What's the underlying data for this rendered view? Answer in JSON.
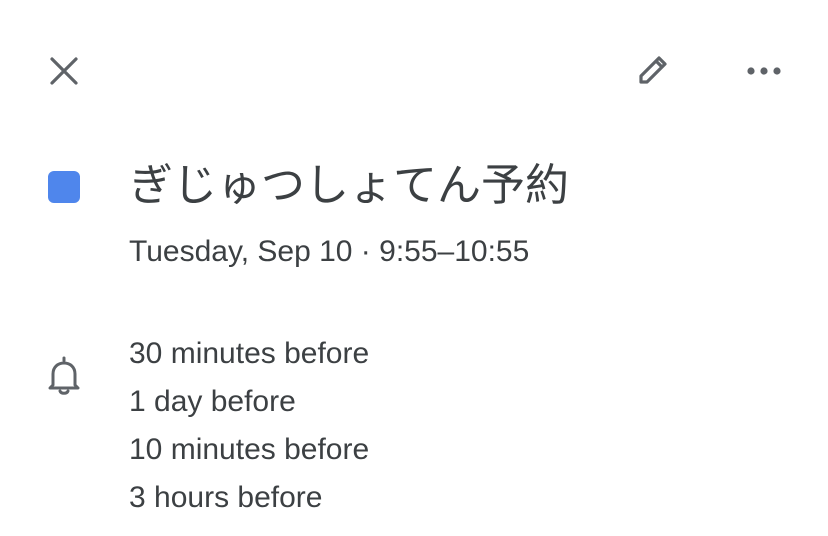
{
  "toolbar": {
    "close_icon": "close-icon",
    "edit_icon": "pencil-icon",
    "more_icon": "more-horizontal-icon"
  },
  "event": {
    "color": "#4f86ec",
    "title": "ぎじゅつしょてん予約",
    "datetime": "Tuesday, Sep 10 · 9:55–10:55"
  },
  "reminders": {
    "icon": "bell-icon",
    "items": [
      "30 minutes before",
      "1 day before",
      "10 minutes before",
      "3 hours before"
    ]
  },
  "colors": {
    "text": "#3c4043",
    "icon": "#5f6368"
  }
}
